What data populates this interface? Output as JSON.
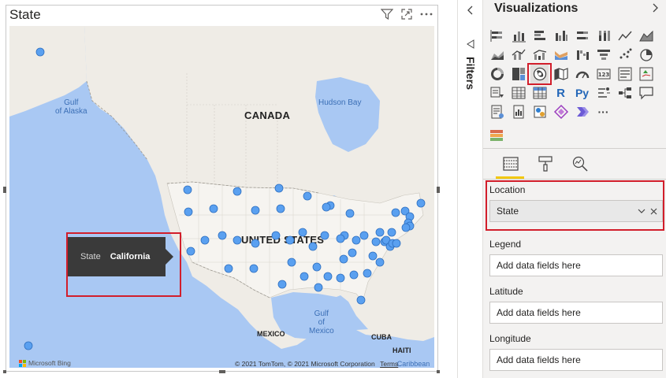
{
  "visual": {
    "title": "State"
  },
  "map": {
    "labels": {
      "gulf_alaska": "Gulf\nof Alaska",
      "hudson_bay": "Hudson Bay",
      "canada": "CANADA",
      "united_states": "UNITED STATES",
      "gulf_mexico": "Gulf\nof\nMexico",
      "mexico": "MEXICO",
      "cuba": "CUBA",
      "haiti": "HAITI",
      "caribbean": "Caribbean Se"
    },
    "attribution": "© 2021 TomTom, © 2021 Microsoft Corporation",
    "terms": "Terms",
    "bing": "Microsoft Bing",
    "point_color": "#5aa0f0"
  },
  "tooltip": {
    "key": "State",
    "value": "California"
  },
  "filters": {
    "label": "Filters"
  },
  "pane": {
    "title": "Visualizations",
    "fields": {
      "location_label": "Location",
      "location_value": "State",
      "legend_label": "Legend",
      "legend_placeholder": "Add data fields here",
      "latitude_label": "Latitude",
      "latitude_placeholder": "Add data fields here",
      "longitude_label": "Longitude",
      "longitude_placeholder": "Add data fields here"
    },
    "icons": [
      "stacked-bar-icon",
      "stacked-column-icon",
      "clustered-bar-icon",
      "clustered-column-icon",
      "100-bar-icon",
      "100-column-icon",
      "line-chart-icon",
      "area-chart-icon",
      "stacked-area-icon",
      "line-column-icon",
      "line-clustered-icon",
      "ribbon-chart-icon",
      "waterfall-icon",
      "funnel-icon",
      "scatter-icon",
      "pie-chart-icon",
      "donut-icon",
      "treemap-icon",
      "map-icon",
      "filled-map-icon",
      "gauge-icon",
      "card-icon",
      "multirow-card-icon",
      "kpi-icon",
      "slicer-icon",
      "table-icon",
      "matrix-icon",
      "r-visual-icon",
      "python-visual-icon",
      "key-influencers-icon",
      "decomposition-tree-icon",
      "qa-icon",
      "smart-narrative-icon",
      "paginated-icon",
      "arcgis-icon",
      "power-apps-icon",
      "power-automate-icon",
      "more-icon"
    ],
    "glyphs": {
      "r": "R",
      "py": "Py",
      "more": "···"
    },
    "accent": "#f2c811",
    "highlight": "#d21e2b"
  }
}
